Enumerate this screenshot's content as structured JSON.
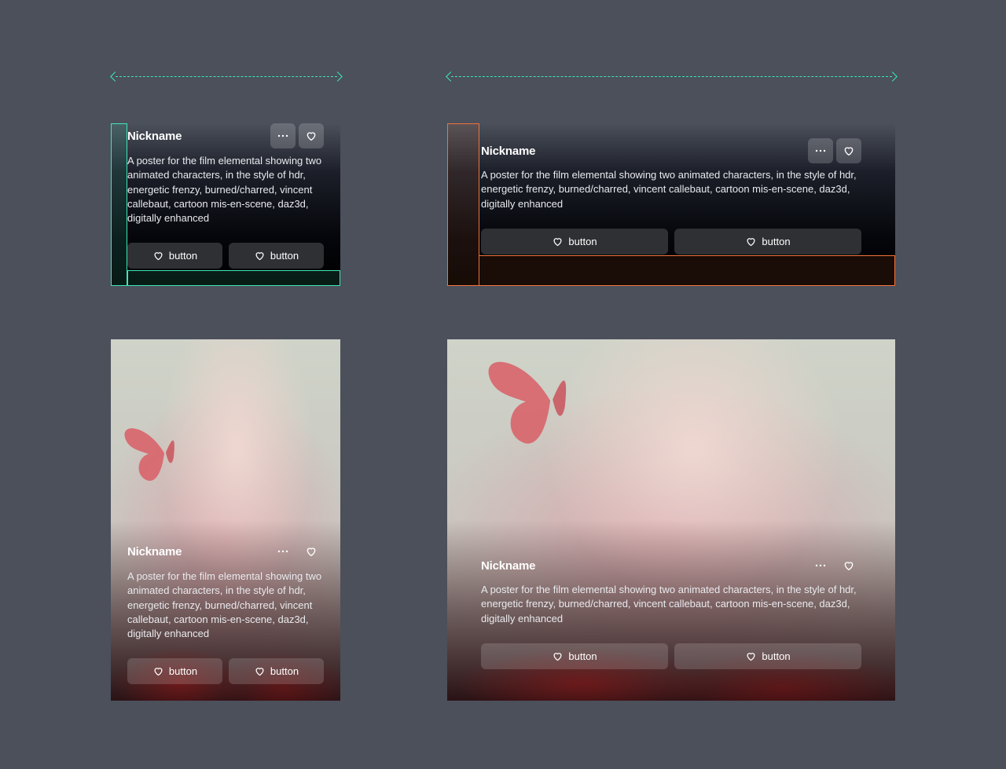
{
  "colors": {
    "canvas": "#4b505b",
    "width_indicator": "#3ee6b6",
    "padding_highlight_narrow": "#3ee6b6",
    "padding_highlight_wide": "#f0733a"
  },
  "cards": [
    {
      "id": "narrow-dark",
      "nickname": "Nickname",
      "description": "A poster for the film elemental showing two animated characters, in the style of hdr, energetic frenzy, burned/charred, vincent callebaut, cartoon mis-en-scene, daz3d, digitally enhanced",
      "more_icon": "more-horizontal-icon",
      "like_icon": "heart-icon",
      "buttons": [
        "button",
        "button"
      ]
    },
    {
      "id": "wide-dark",
      "nickname": "Nickname",
      "description": "A poster for the film elemental showing two animated characters, in the style of hdr, energetic frenzy, burned/charred, vincent callebaut, cartoon mis-en-scene, daz3d, digitally enhanced",
      "more_icon": "more-horizontal-icon",
      "like_icon": "heart-icon",
      "buttons": [
        "button",
        "button"
      ]
    },
    {
      "id": "narrow-image",
      "nickname": "Nickname",
      "description": "A poster for the film elemental showing two animated characters, in the style of hdr, energetic frenzy, burned/charred, vincent callebaut, cartoon mis-en-scene, daz3d, digitally enhanced",
      "more_icon": "more-horizontal-icon",
      "like_icon": "heart-icon",
      "buttons": [
        "button",
        "button"
      ]
    },
    {
      "id": "wide-image",
      "nickname": "Nickname",
      "description": "A poster for the film elemental showing two animated characters, in the style of hdr, energetic frenzy, burned/charred, vincent callebaut, cartoon mis-en-scene, daz3d, digitally enhanced",
      "more_icon": "more-horizontal-icon",
      "like_icon": "heart-icon",
      "buttons": [
        "button",
        "button"
      ]
    }
  ]
}
